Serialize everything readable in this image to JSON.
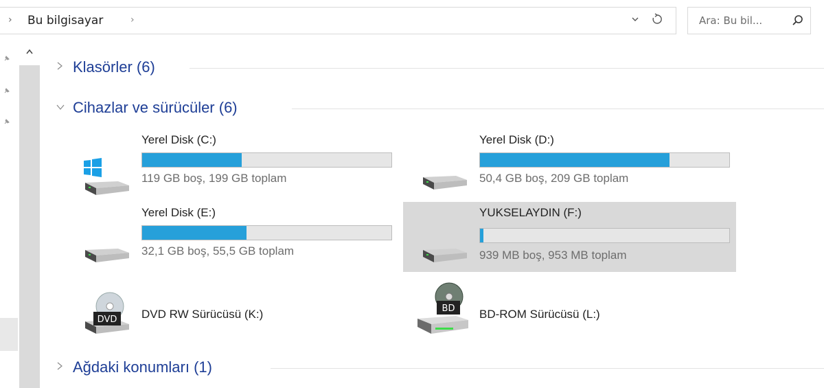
{
  "address_bar": {
    "crumb": "Bu bilgisayar",
    "nav_chevron": "›",
    "dropdown_icon": "chevron-down-icon",
    "refresh_icon": "refresh-icon"
  },
  "search": {
    "placeholder": "Ara: Bu bil...",
    "icon": "search-icon"
  },
  "sections": {
    "folders": {
      "title": "Klasörler (6)",
      "expanded": false
    },
    "devices": {
      "title": "Cihazlar ve sürücüler (6)",
      "expanded": true
    },
    "network": {
      "title": "Ağdaki konumları (1)",
      "expanded": false
    }
  },
  "drives": [
    {
      "name": "Yerel Disk (C:)",
      "space": "119 GB boş, 199 GB toplam",
      "used_fraction": 0.4,
      "icon": "windows-drive-icon",
      "selected": false
    },
    {
      "name": "Yerel Disk (D:)",
      "space": "50,4 GB boş, 209 GB toplam",
      "used_fraction": 0.76,
      "icon": "hard-drive-icon",
      "selected": false
    },
    {
      "name": "Yerel Disk (E:)",
      "space": "32,1 GB boş, 55,5 GB toplam",
      "used_fraction": 0.42,
      "icon": "hard-drive-icon",
      "selected": false
    },
    {
      "name": "YUKSELAYDIN (F:)",
      "space": "939 MB boş, 953 MB toplam",
      "used_fraction": 0.015,
      "icon": "hard-drive-icon",
      "selected": true
    }
  ],
  "optical": [
    {
      "name": "DVD RW Sürücüsü (K:)",
      "badge": "DVD",
      "icon": "dvd-drive-icon"
    },
    {
      "name": "BD-ROM Sürücüsü (L:)",
      "badge": "BD",
      "icon": "bd-drive-icon"
    }
  ],
  "colors": {
    "accent": "#26a0da",
    "section_title": "#1e3e96",
    "selected_bg": "#d9d9d9"
  }
}
